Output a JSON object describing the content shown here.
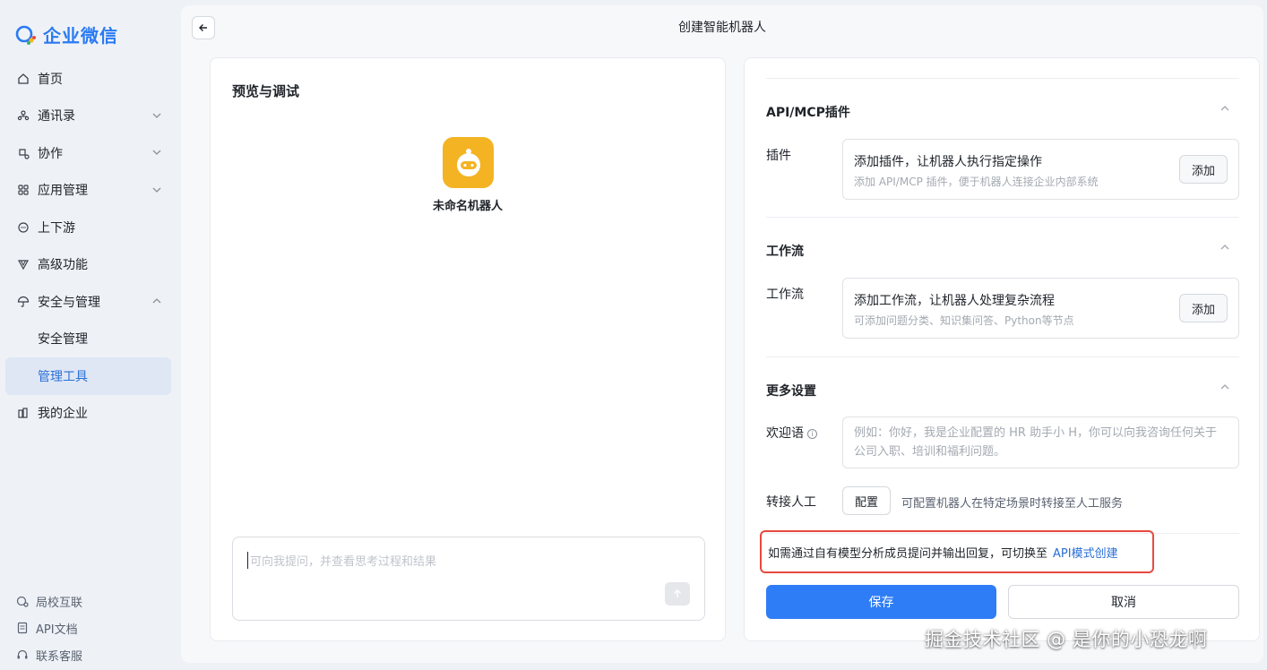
{
  "app": {
    "name": "企业微信",
    "brand_color": "#2a7af4"
  },
  "sidebar": {
    "items": [
      {
        "label": "首页",
        "icon": "home-icon"
      },
      {
        "label": "通讯录",
        "icon": "contacts-icon",
        "expandable": true
      },
      {
        "label": "协作",
        "icon": "collab-icon",
        "expandable": true
      },
      {
        "label": "应用管理",
        "icon": "apps-icon",
        "expandable": true
      },
      {
        "label": "上下游",
        "icon": "chat-bubble-icon"
      },
      {
        "label": "高级功能",
        "icon": "advanced-icon"
      },
      {
        "label": "安全与管理",
        "icon": "umbrella-icon",
        "expanded": true
      },
      {
        "label": "安全管理"
      },
      {
        "label": "管理工具",
        "active": true
      },
      {
        "label": "我的企业",
        "icon": "enterprise-icon"
      }
    ],
    "bottom_links": [
      {
        "label": "局校互联",
        "icon": "link-icon"
      },
      {
        "label": "API文档",
        "icon": "doc-icon"
      },
      {
        "label": "联系客服",
        "icon": "headset-icon"
      }
    ]
  },
  "header": {
    "title": "创建智能机器人"
  },
  "preview": {
    "title": "预览与调试",
    "bot_name": "未命名机器人",
    "input_placeholder": "可向我提问，并查看思考过程和结果"
  },
  "settings": {
    "plugins": {
      "section_title": "API/MCP插件",
      "label": "插件",
      "box_title": "添加插件，让机器人执行指定操作",
      "box_sub": "添加 API/MCP 插件，便于机器人连接企业内部系统",
      "add_label": "添加"
    },
    "workflow": {
      "section_title": "工作流",
      "label": "工作流",
      "box_title": "添加工作流，让机器人处理复杂流程",
      "box_sub": "可添加问题分类、知识集问答、Python等节点",
      "add_label": "添加"
    },
    "more": {
      "section_title": "更多设置",
      "welcome_label": "欢迎语",
      "welcome_placeholder": "例如：你好，我是企业配置的 HR 助手小 H，你可以向我咨询任何关于公司入职、培训和福利问题。",
      "transfer_label": "转接人工",
      "config_label": "配置",
      "transfer_desc": "可配置机器人在特定场景时转接至人工服务"
    },
    "api_hint": {
      "text": "如需通过自有模型分析成员提问并输出回复，可切换至",
      "link": "API模式创建"
    },
    "save_label": "保存",
    "cancel_label": "取消"
  },
  "watermark": "掘金技术社区 @ 是你的小恐龙啊"
}
